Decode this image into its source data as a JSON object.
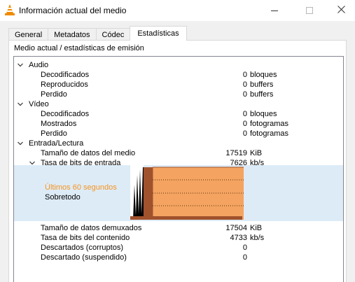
{
  "window": {
    "title": "Información actual del medio",
    "icon": "vlc-cone-icon"
  },
  "tabs": [
    {
      "label": "General"
    },
    {
      "label": "Metadatos"
    },
    {
      "label": "Códec"
    },
    {
      "label": "Estadísticas"
    }
  ],
  "active_tab": "Estadísticas",
  "panel": {
    "heading": "Medio actual / estadísticas de emisión"
  },
  "colors": {
    "graph_fill": "#f4a460",
    "graph_edge": "#a0522d",
    "graph_band": "#ddebf7",
    "accent_orange": "#f7941d"
  },
  "stats": {
    "audio": {
      "label": "Audio",
      "decoded": {
        "label": "Decodificados",
        "value": "0",
        "unit": "bloques"
      },
      "played": {
        "label": "Reproducidos",
        "value": "0",
        "unit": "buffers"
      },
      "lost": {
        "label": "Perdido",
        "value": "0",
        "unit": "buffers"
      }
    },
    "video": {
      "label": "Vídeo",
      "decoded": {
        "label": "Decodificados",
        "value": "0",
        "unit": "bloques"
      },
      "shown": {
        "label": "Mostrados",
        "value": "0",
        "unit": "fotogramas"
      },
      "lost": {
        "label": "Perdido",
        "value": "0",
        "unit": "fotogramas"
      }
    },
    "input": {
      "label": "Entrada/Lectura",
      "media_size": {
        "label": "Tamaño de datos del medio",
        "value": "17519",
        "unit": "KiB"
      },
      "input_bitrate": {
        "label": "Tasa de bits de entrada",
        "value": "7626",
        "unit": "kb/s"
      },
      "graph": {
        "title": "Últimos 60 segundos",
        "subtitle": "Sobretodo"
      },
      "demux_size": {
        "label": "Tamaño de datos demuxados",
        "value": "17504",
        "unit": "KiB"
      },
      "content_bitrate": {
        "label": "Tasa de bits del contenido",
        "value": "4733",
        "unit": "kb/s"
      },
      "discarded_corrupt": {
        "label": "Descartados (corruptos)",
        "value": "0"
      },
      "discarded_suspended": {
        "label": "Descartado (suspendido)",
        "value": "0"
      }
    }
  }
}
